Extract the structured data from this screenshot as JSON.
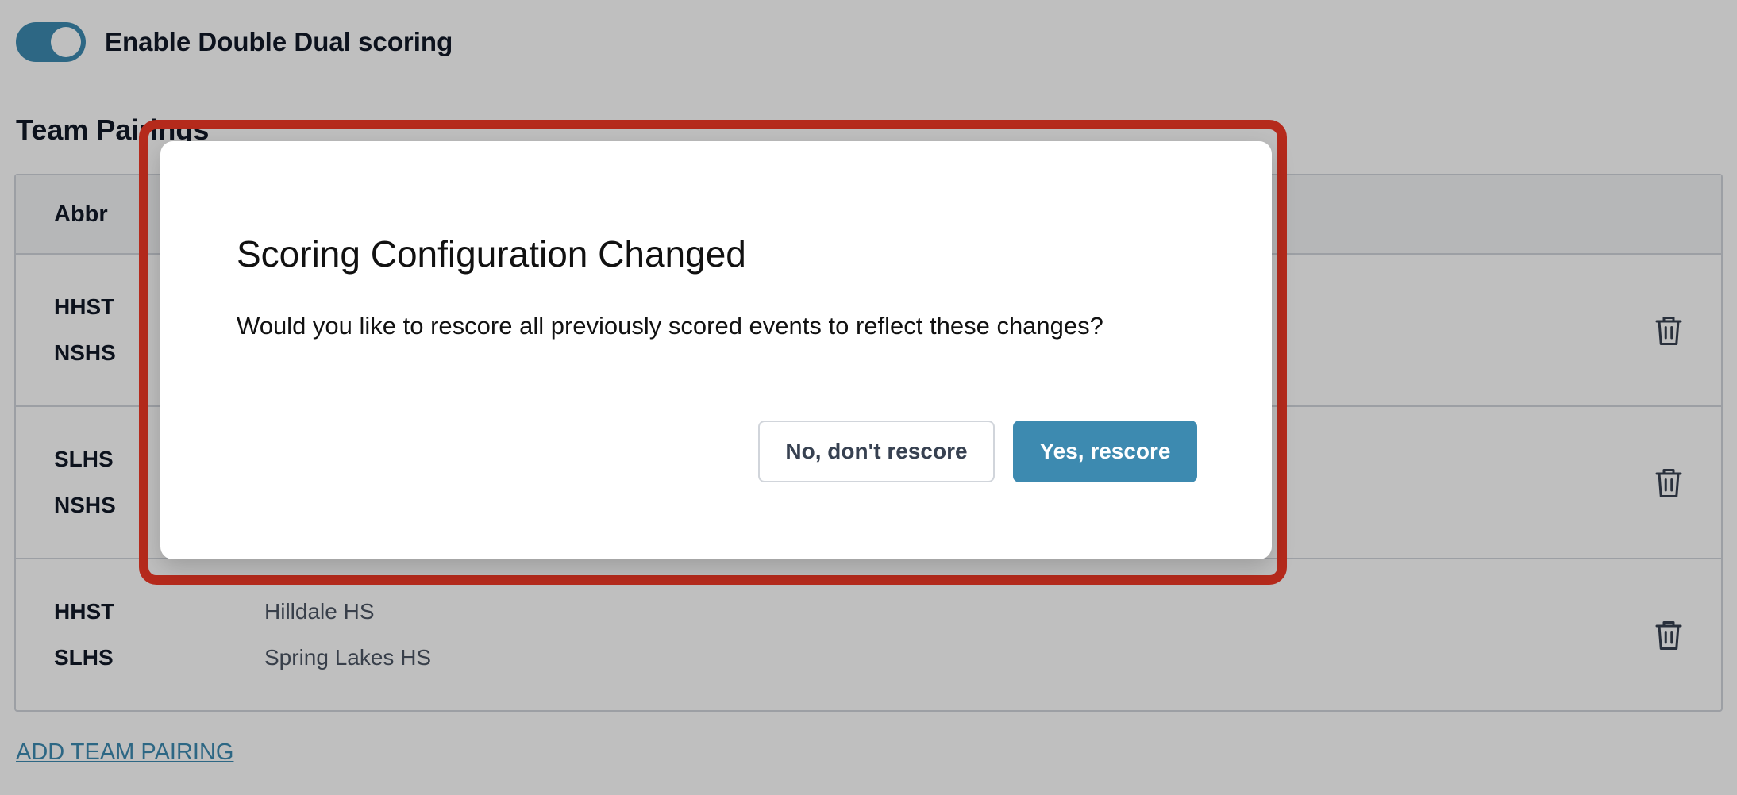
{
  "settings": {
    "toggle_label": "Enable Double Dual scoring",
    "toggle_on": true
  },
  "team_pairings": {
    "title": "Team Pairings",
    "column_abbr": "Abbr",
    "rows": [
      {
        "team1_abbr": "HHST",
        "team2_abbr": "NSHS",
        "team1_name": "",
        "team2_name": ""
      },
      {
        "team1_abbr": "SLHS",
        "team2_abbr": "NSHS",
        "team1_name": "",
        "team2_name": ""
      },
      {
        "team1_abbr": "HHST",
        "team2_abbr": "SLHS",
        "team1_name": "Hilldale HS",
        "team2_name": "Spring Lakes HS"
      }
    ],
    "add_link": "ADD TEAM PAIRING"
  },
  "modal": {
    "title": "Scoring Configuration Changed",
    "message": "Would you like to rescore all previously scored events to reflect these changes?",
    "cancel_label": "No, don't rescore",
    "confirm_label": "Yes, rescore"
  },
  "icons": {
    "row_action": "trash-icon"
  },
  "colors": {
    "accent": "#3d8ab0",
    "highlight_border": "#b52a1c",
    "overlay": "rgba(0,0,0,0.25)"
  }
}
